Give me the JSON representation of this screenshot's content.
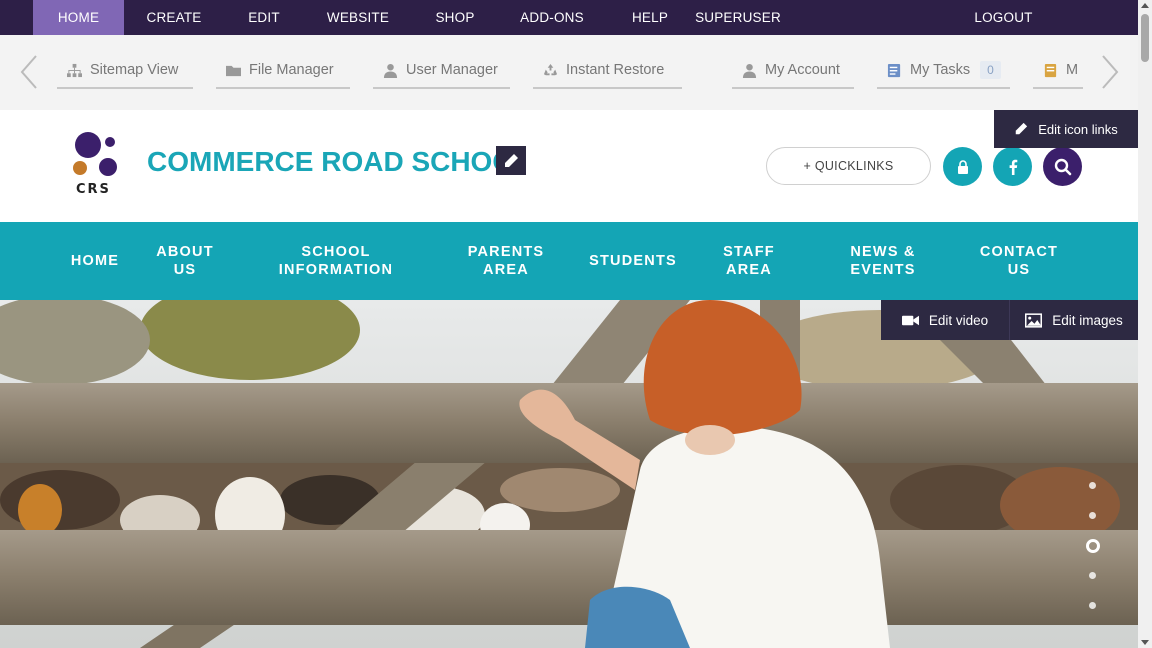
{
  "admin_bar": {
    "items": [
      "HOME",
      "CREATE",
      "EDIT",
      "WEBSITE",
      "SHOP",
      "ADD-ONS",
      "HELP",
      "SUPERUSER"
    ],
    "active": "HOME",
    "logout": "LOGOUT"
  },
  "toolbar": {
    "tools": [
      {
        "label": "Sitemap View",
        "icon": "sitemap-icon"
      },
      {
        "label": "File Manager",
        "icon": "folder-icon"
      },
      {
        "label": "User Manager",
        "icon": "user-icon"
      },
      {
        "label": "Instant Restore",
        "icon": "recycle-icon"
      },
      {
        "label": "My Account",
        "icon": "user-icon"
      },
      {
        "label": "My Tasks",
        "icon": "tasks-icon",
        "badge": "0"
      },
      {
        "label": "M",
        "icon": "document-icon"
      }
    ]
  },
  "header": {
    "logo_text": "CRS",
    "school_name": "COMMERCE ROAD SCHOOL",
    "quicklinks": "+ QUICKLINKS",
    "edit_icon_links": "Edit icon links"
  },
  "main_nav": {
    "items": [
      "HOME",
      "ABOUT\nUS",
      "SCHOOL\nINFORMATION",
      "PARENTS\nAREA",
      "STUDENTS",
      "STAFF\nAREA",
      "NEWS &\nEVENTS",
      "CONTACT\nUS"
    ]
  },
  "hero": {
    "edit_video": "Edit video",
    "edit_images": "Edit images",
    "slide_count": 5,
    "active_slide": 3
  },
  "colors": {
    "admin_bar": "#2d1f47",
    "admin_active": "#8067b5",
    "teal": "#14a5b5",
    "dark_button": "#2d2942",
    "purple": "#3b1f6b"
  }
}
